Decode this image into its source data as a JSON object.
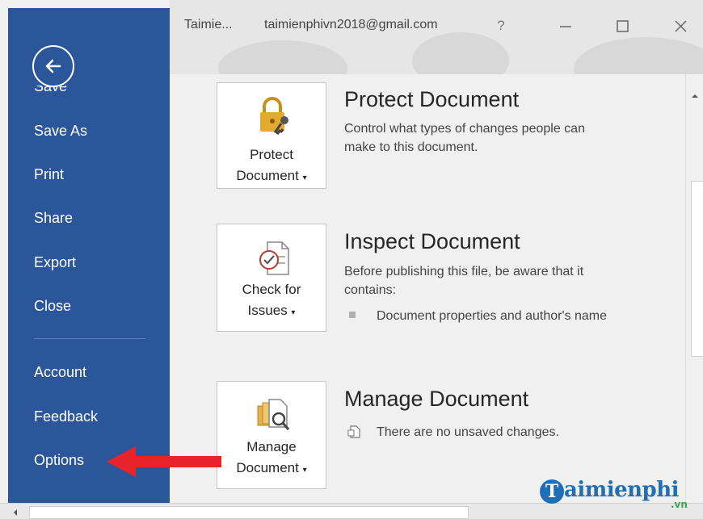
{
  "titlebar": {
    "doc_name": "Taimie...",
    "account_email": "taimienphivn2018@gmail.com",
    "help_label": "?"
  },
  "sidebar": {
    "partial_item": "Save",
    "items": [
      {
        "label": "Save As"
      },
      {
        "label": "Print"
      },
      {
        "label": "Share"
      },
      {
        "label": "Export"
      },
      {
        "label": "Close"
      },
      {
        "label": "Account"
      },
      {
        "label": "Feedback"
      },
      {
        "label": "Options"
      }
    ]
  },
  "sections": {
    "protect": {
      "button_line1": "Protect",
      "button_line2": "Document",
      "title": "Protect Document",
      "description": "Control what types of changes people can make to this document."
    },
    "inspect": {
      "button_line1": "Check for",
      "button_line2": "Issues",
      "title": "Inspect Document",
      "description": "Before publishing this file, be aware that it contains:",
      "bullets": [
        "Document properties and author's name"
      ]
    },
    "manage": {
      "button_line1": "Manage",
      "button_line2": "Document",
      "title": "Manage Document",
      "status": "There are no unsaved changes."
    }
  },
  "watermark": {
    "initial": "T",
    "brand": "aimienphi",
    "suffix": ".vn"
  },
  "icons": {
    "back": "back-arrow-icon",
    "protect": "lock-key-icon",
    "inspect": "check-document-icon",
    "manage": "manage-documents-icon",
    "status": "document-status-icon",
    "minimize": "minimize-icon",
    "maximize": "maximize-icon",
    "close": "close-icon"
  },
  "colors": {
    "sidebar": "#2b579a",
    "arrow": "#e8232b",
    "brand": "#1f6fb8",
    "lock": "#e1ab2f"
  }
}
